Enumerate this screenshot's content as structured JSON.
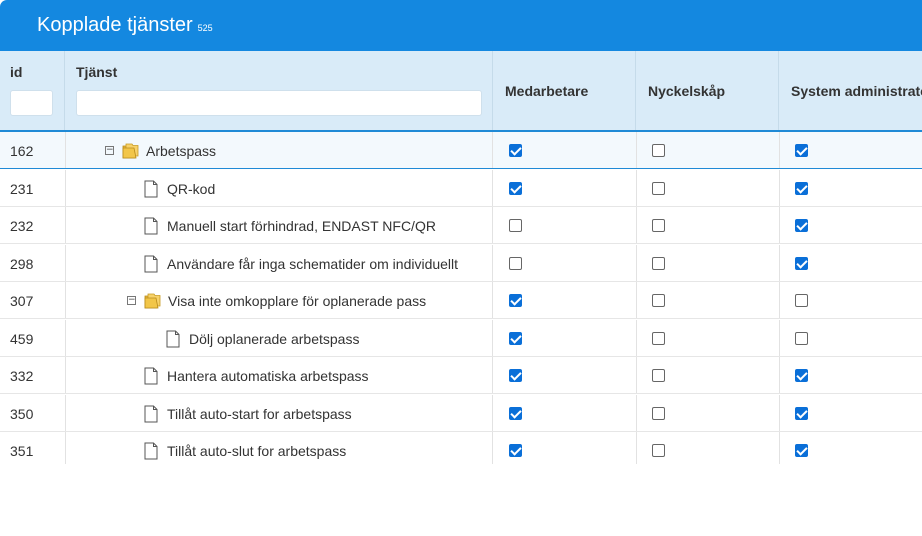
{
  "window": {
    "title": "Kopplade tjänster",
    "count": "525"
  },
  "columns": {
    "id": "id",
    "service": "Tjänst",
    "roles": [
      "Medarbetare",
      "Nyckelskåp",
      "System administratör"
    ]
  },
  "filters": {
    "id_value": "",
    "service_value": ""
  },
  "rows": [
    {
      "id": "162",
      "name": "Arbetspass",
      "type": "folder",
      "level": 0,
      "expanded": true,
      "selected": true,
      "checks": [
        true,
        false,
        true
      ]
    },
    {
      "id": "231",
      "name": "QR-kod",
      "type": "doc",
      "level": 1,
      "checks": [
        true,
        false,
        true
      ]
    },
    {
      "id": "232",
      "name": "Manuell start förhindrad, ENDAST NFC/QR",
      "type": "doc",
      "level": 1,
      "checks": [
        false,
        false,
        true
      ]
    },
    {
      "id": "298",
      "name": "Användare får inga schematider om individuellt",
      "type": "doc",
      "level": 1,
      "checks": [
        false,
        false,
        true
      ]
    },
    {
      "id": "307",
      "name": "Visa inte omkopplare för oplanerade pass",
      "type": "folder",
      "level": 1,
      "expanded": true,
      "checks": [
        true,
        false,
        false
      ]
    },
    {
      "id": "459",
      "name": "Dölj oplanerade arbetspass",
      "type": "doc",
      "level": 2,
      "checks": [
        true,
        false,
        false
      ]
    },
    {
      "id": "332",
      "name": "Hantera automatiska arbetspass",
      "type": "doc",
      "level": 1,
      "checks": [
        true,
        false,
        true
      ]
    },
    {
      "id": "350",
      "name": "Tillåt auto-start for arbetspass",
      "type": "doc",
      "level": 1,
      "checks": [
        true,
        false,
        true
      ]
    },
    {
      "id": "351",
      "name": "Tillåt auto-slut for arbetspass",
      "type": "doc",
      "level": 1,
      "checks": [
        true,
        false,
        true
      ]
    }
  ],
  "colors": {
    "titlebar": "#1488e0",
    "header": "#d9ebf8",
    "checked": "#0a6fd8"
  }
}
